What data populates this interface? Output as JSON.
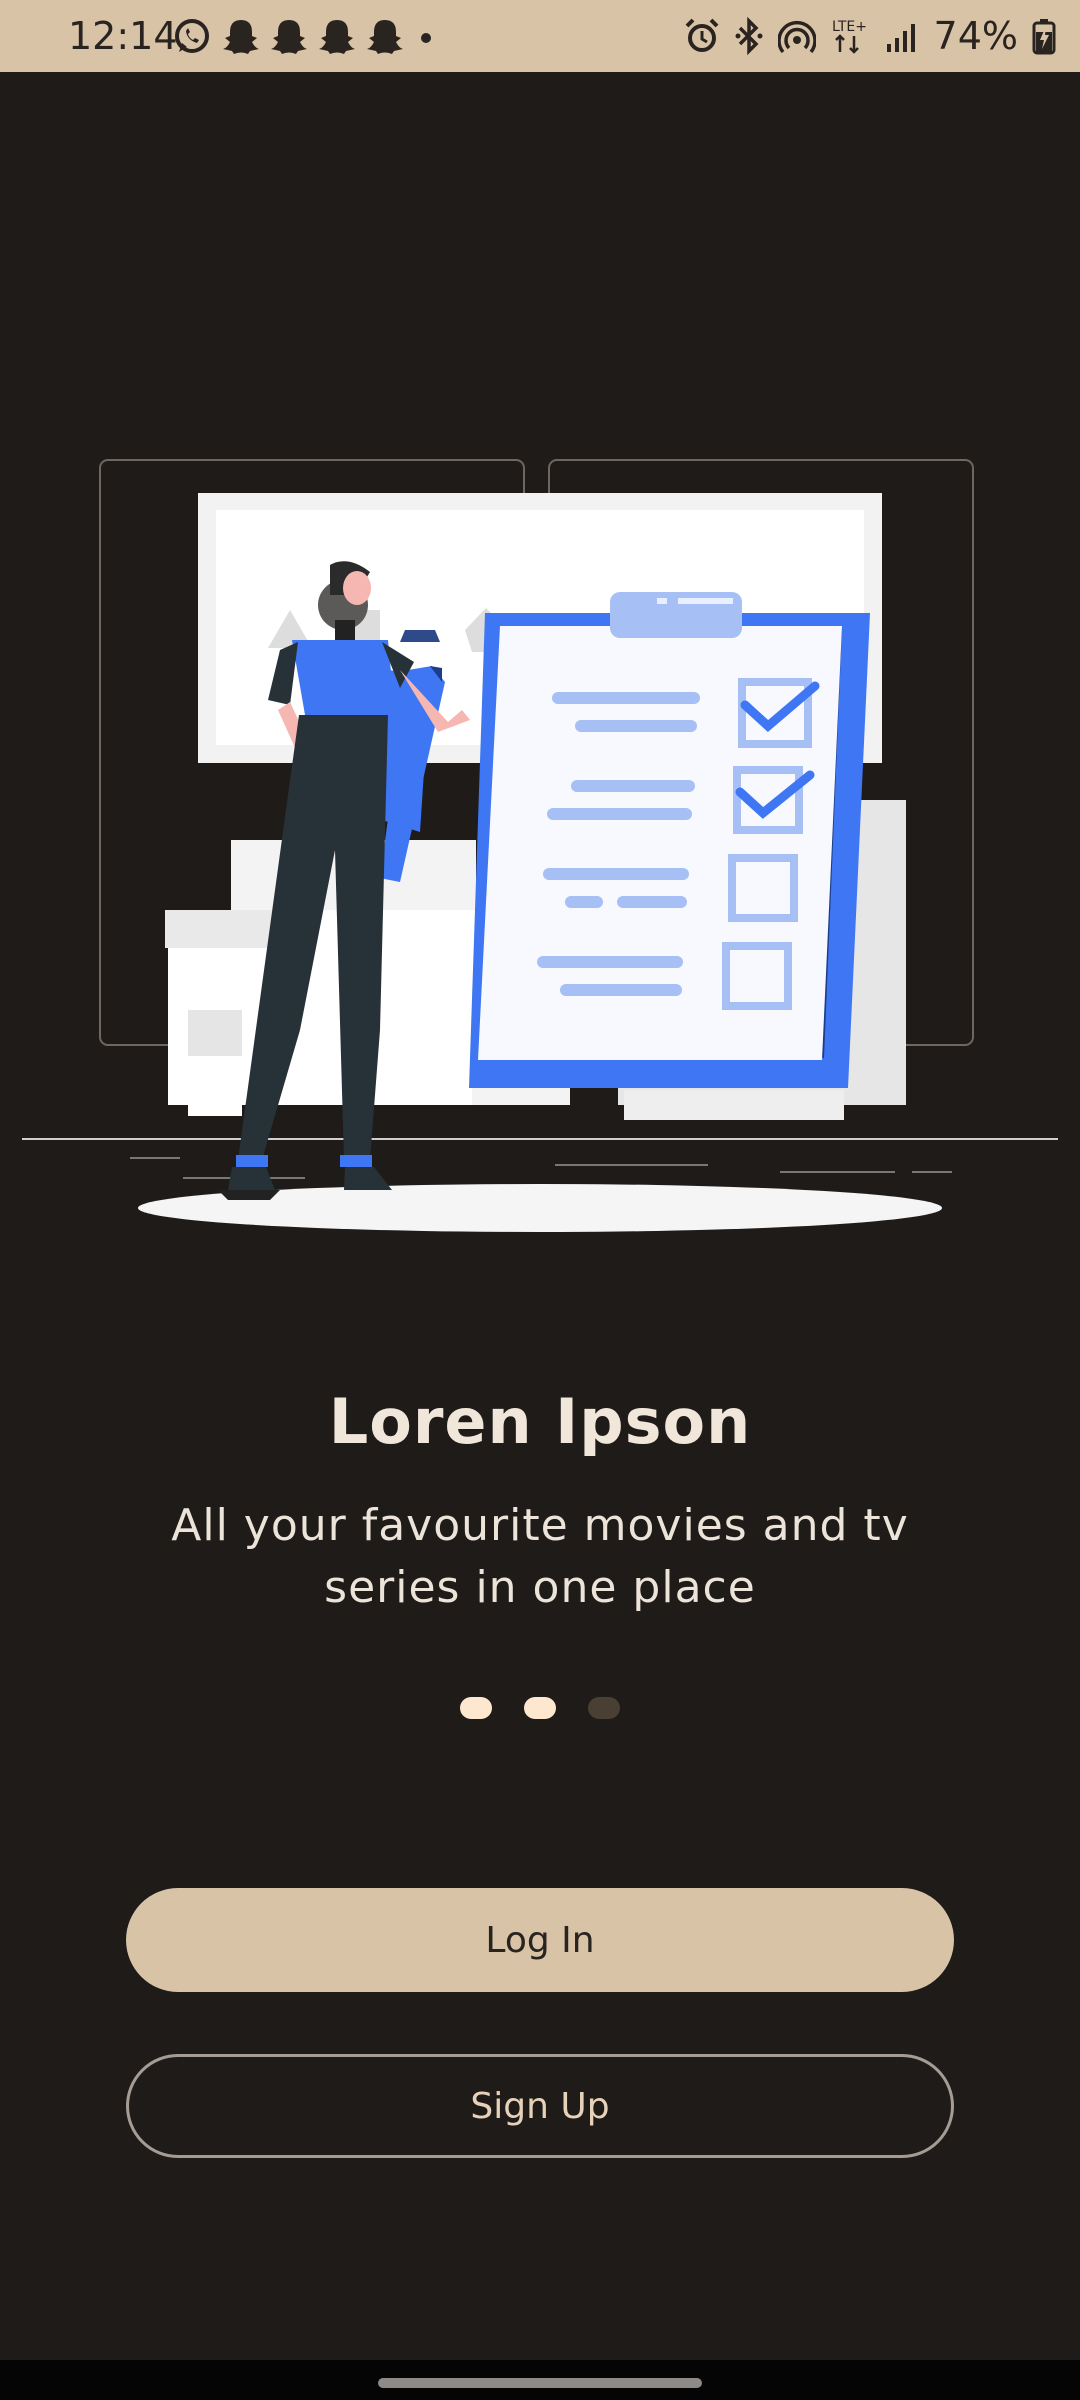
{
  "status_bar": {
    "time": "12:14",
    "battery_percent": "74%",
    "icons_left": [
      "whatsapp-icon",
      "snapchat-icon",
      "snapchat-icon",
      "snapchat-icon",
      "snapchat-icon",
      "dot-icon"
    ],
    "icons_right": [
      "alarm-icon",
      "bluetooth-icon",
      "hotspot-icon",
      "lte-icon",
      "signal-icon",
      "battery-charging-icon"
    ],
    "lte_label": "LTE+"
  },
  "onboarding": {
    "title": "Loren Ipson",
    "subtitle": "All your favourite movies and tv series in one place",
    "page_indicator": {
      "count": 3,
      "active_index": 1
    }
  },
  "buttons": {
    "login_label": "Log In",
    "signup_label": "Sign Up"
  },
  "colors": {
    "background": "#1f1b19",
    "accent": "#d8c3a7",
    "illustration_blue": "#3f76f4",
    "dot_active": "#fde7cf",
    "dot_inactive": "#4a3f33"
  }
}
